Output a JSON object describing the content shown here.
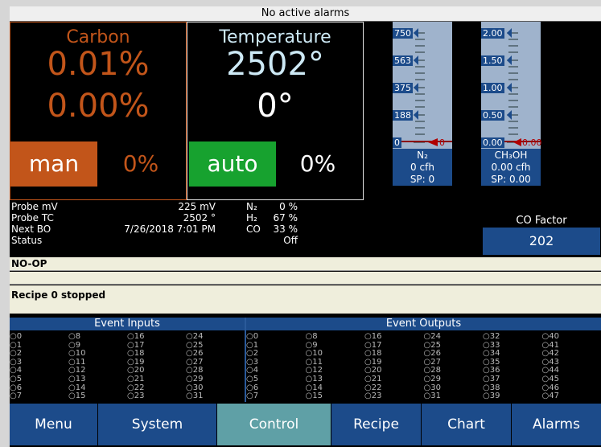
{
  "alarm_bar": {
    "text": "No active alarms"
  },
  "carbon": {
    "title": "Carbon",
    "actual": "0.01%",
    "setpoint": "0.00%",
    "mode": "man",
    "output": "0%"
  },
  "temperature": {
    "title": "Temperature",
    "actual": "2502°",
    "setpoint": "0°",
    "mode": "auto",
    "output": "0%"
  },
  "gauges": [
    {
      "scale": [
        "750",
        "563",
        "375",
        "188",
        "0"
      ],
      "bottom_value": "0",
      "name": "N₂",
      "flow": "0 cfh",
      "sp": "SP: 0",
      "level": 0
    },
    {
      "scale": [
        "2.00",
        "1.50",
        "1.00",
        "0.50",
        "0.00"
      ],
      "bottom_value": "0.00",
      "name": "CH₃OH",
      "flow": "0.00 cfh",
      "sp": "SP: 0.00",
      "level": 0
    }
  ],
  "readings": {
    "probe_mv_label": "Probe mV",
    "probe_mv_value": "225 mV",
    "probe_tc_label": "Probe TC",
    "probe_tc_value": "2502 °",
    "next_bo_label": "Next BO",
    "next_bo_value": "7/26/2018 7:01 PM",
    "status_label": "Status",
    "status_value": "Off",
    "n2_label": "N₂",
    "n2_value": "0 %",
    "h2_label": "H₂",
    "h2_value": "67 %",
    "co_label": "CO",
    "co_value": "33 %"
  },
  "co_factor": {
    "label": "CO Factor",
    "value": "202"
  },
  "status_line": "NO-OP",
  "recipe_line": "Recipe 0 stopped",
  "io": {
    "inputs_title": "Event Inputs",
    "outputs_title": "Event Outputs",
    "input_columns": [
      [
        "0",
        "1",
        "2",
        "3",
        "4",
        "5",
        "6",
        "7"
      ],
      [
        "8",
        "9",
        "10",
        "11",
        "12",
        "13",
        "14",
        "15"
      ],
      [
        "16",
        "17",
        "18",
        "19",
        "20",
        "21",
        "22",
        "23"
      ],
      [
        "24",
        "25",
        "26",
        "27",
        "28",
        "29",
        "30",
        "31"
      ]
    ],
    "output_columns": [
      [
        "0",
        "1",
        "2",
        "3",
        "4",
        "5",
        "6",
        "7"
      ],
      [
        "8",
        "9",
        "10",
        "11",
        "12",
        "13",
        "14",
        "15"
      ],
      [
        "16",
        "17",
        "18",
        "19",
        "20",
        "21",
        "22",
        "23"
      ],
      [
        "24",
        "25",
        "26",
        "27",
        "28",
        "29",
        "30",
        "31"
      ],
      [
        "32",
        "33",
        "34",
        "35",
        "36",
        "37",
        "38",
        "39"
      ],
      [
        "40",
        "41",
        "42",
        "43",
        "44",
        "45",
        "46",
        "47"
      ]
    ]
  },
  "nav": {
    "menu": "Menu",
    "system": "System",
    "control": "Control",
    "recipe": "Recipe",
    "chart": "Chart",
    "alarms": "Alarms"
  },
  "colors": {
    "carbon_orange": "#c2551a",
    "temp_text": "#cde9f5",
    "auto_green": "#17a22f",
    "nav_blue": "#1c4b8a",
    "nav_active": "#5fa0a6"
  }
}
